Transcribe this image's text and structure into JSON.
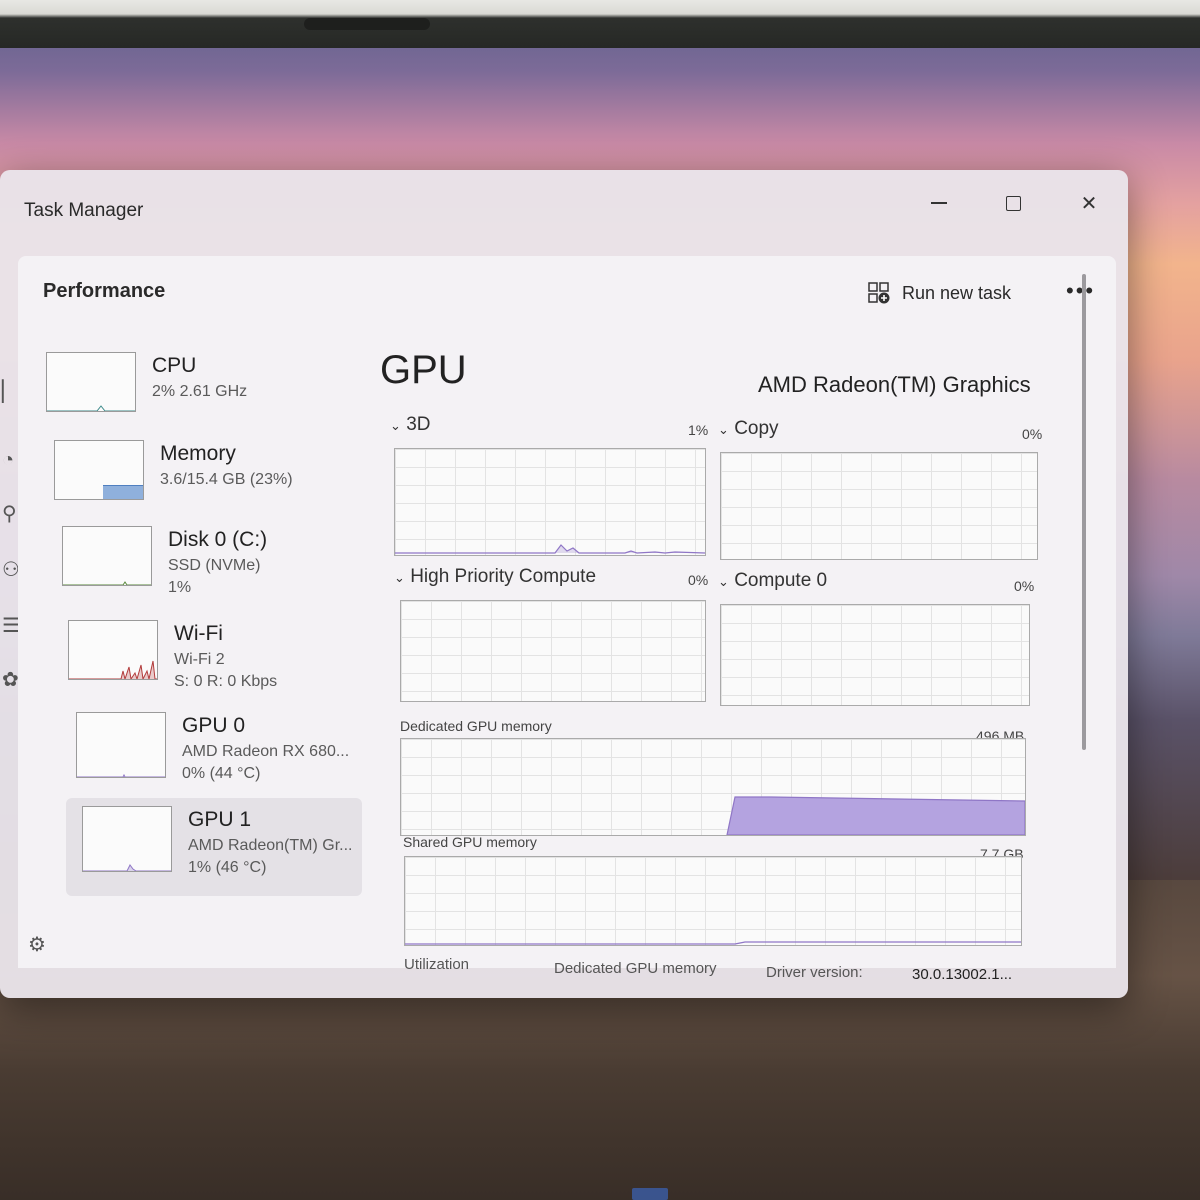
{
  "window": {
    "title": "Task Manager",
    "minimize_icon": "minimize-icon",
    "maximize_icon": "maximize-icon",
    "close_glyph": "✕"
  },
  "header": {
    "page_title": "Performance",
    "run_new_task": "Run new task",
    "more_glyph": "•••"
  },
  "devices": [
    {
      "name": "CPU",
      "line1": "2%  2.61 GHz",
      "line2": ""
    },
    {
      "name": "Memory",
      "line1": "3.6/15.4 GB (23%)",
      "line2": ""
    },
    {
      "name": "Disk 0 (C:)",
      "line1": "SSD (NVMe)",
      "line2": "1%"
    },
    {
      "name": "Wi-Fi",
      "line1": "Wi-Fi 2",
      "line2": "S: 0 R: 0 Kbps"
    },
    {
      "name": "GPU 0",
      "line1": "AMD Radeon RX 680...",
      "line2": "0% (44 °C)"
    },
    {
      "name": "GPU 1",
      "line1": "AMD Radeon(TM) Gr...",
      "line2": "1% (46 °C)"
    }
  ],
  "detail": {
    "title": "GPU",
    "model": "AMD Radeon(TM) Graphics",
    "engines": [
      {
        "label": "3D",
        "percent": "1%"
      },
      {
        "label": "Copy",
        "percent": "0%"
      },
      {
        "label": "High Priority Compute",
        "percent": "0%"
      },
      {
        "label": "Compute 0",
        "percent": "0%"
      }
    ],
    "dedicated": {
      "label": "Dedicated GPU memory",
      "max": "496 MB"
    },
    "shared": {
      "label": "Shared GPU memory",
      "max": "7.7 GB"
    },
    "footer": {
      "utilization": "Utilization",
      "dedicated": "Dedicated GPU memory",
      "driver_label": "Driver version:",
      "driver_value": "30.0.13002.1..."
    }
  },
  "colors": {
    "accent_purple": "#8f76c6",
    "memory_blue": "#4f7fc0",
    "wifi_red": "#b23b3b"
  }
}
